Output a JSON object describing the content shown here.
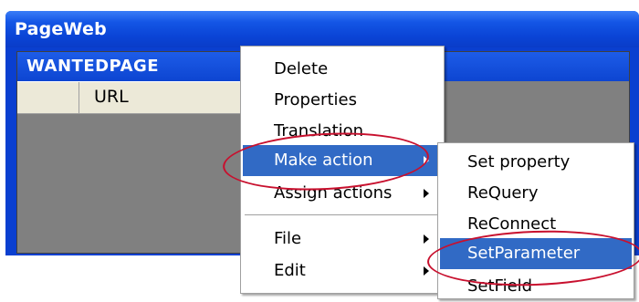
{
  "window": {
    "title": "PageWeb"
  },
  "grid": {
    "header": "WANTEDPAGE",
    "row": {
      "cell": "URL"
    }
  },
  "context_menu": {
    "items": [
      {
        "label": "Delete"
      },
      {
        "label": "Properties"
      },
      {
        "label": "Translation"
      },
      {
        "label": "Make action",
        "submenu": true,
        "highlighted": true
      },
      {
        "label": "Assign actions",
        "submenu": true
      },
      {
        "label": "File",
        "submenu": true
      },
      {
        "label": "Edit",
        "submenu": true
      }
    ]
  },
  "submenu": {
    "items": [
      {
        "label": "Set property"
      },
      {
        "label": "ReQuery"
      },
      {
        "label": "ReConnect"
      },
      {
        "label": "SetParameter",
        "highlighted": true
      },
      {
        "label": "SetField"
      }
    ]
  },
  "colors": {
    "title_bar": "#0a44d6",
    "highlight": "#316ac5",
    "annotation": "#c8102e"
  }
}
